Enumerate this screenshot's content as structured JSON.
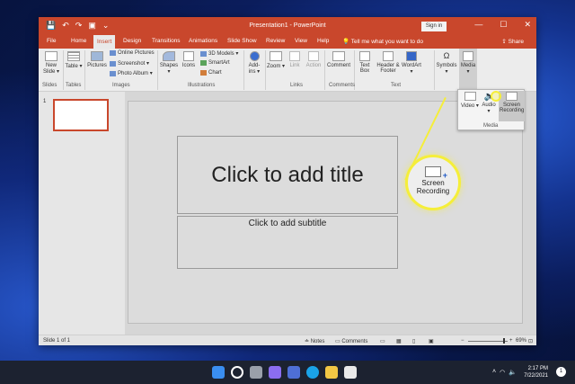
{
  "app": {
    "title": "Presentation1 - PowerPoint",
    "signin": "Sign in",
    "qat": [
      "💾",
      "↶",
      "↷",
      "▣",
      "⌄"
    ],
    "window_controls": [
      "—",
      "☐",
      "✕"
    ]
  },
  "tabs": [
    "File",
    "Home",
    "Insert",
    "Design",
    "Transitions",
    "Animations",
    "Slide Show",
    "Review",
    "View",
    "Help"
  ],
  "active_tab": "Insert",
  "tellme": "Tell me what you want to do",
  "share": "Share",
  "ribbon": {
    "new_slide": "New Slide ▾",
    "table": "Table ▾",
    "pictures": "Pictures",
    "online_pictures": "Online Pictures",
    "screenshot": "Screenshot ▾",
    "photo_album": "Photo Album ▾",
    "shapes": "Shapes ▾",
    "icons": "Icons",
    "models3d": "3D Models ▾",
    "smartart": "SmartArt",
    "chart": "Chart",
    "addins": "Add-ins ▾",
    "zoom": "Zoom ▾",
    "link": "Link",
    "action": "Action",
    "comment": "Comment",
    "textbox": "Text Box",
    "header_footer": "Header & Footer",
    "wordart": "WordArt ▾",
    "symbols": "Symbols ▾",
    "media": "Media ▾",
    "groups": {
      "slides": "Slides",
      "tables": "Tables",
      "images": "Images",
      "illustrations": "Illustrations",
      "links": "Links",
      "comments": "Comments",
      "text": "Text"
    }
  },
  "media_dropdown": {
    "video": "Video ▾",
    "audio": "Audio ▾",
    "screen_recording": "Screen Recording",
    "group": "Media"
  },
  "slide_panel": {
    "slide_number": "1"
  },
  "slide": {
    "title_placeholder": "Click to add title",
    "subtitle_placeholder": "Click to add subtitle"
  },
  "callout": {
    "label": "Screen Recording"
  },
  "statusbar": {
    "slide_info": "Slide 1 of 1",
    "notes": "≐ Notes",
    "comments": "▭ Comments",
    "zoom": "69%"
  },
  "taskbar": {
    "time": "2:17 PM",
    "date": "7/22/2021",
    "notifications": "1",
    "icons_colors": [
      "#3a8ef0",
      "#ffffff",
      "#9aa0aa",
      "#8b6df0",
      "#4e6fd6",
      "#1aa3e8",
      "#f2c744",
      "#e9e9e9"
    ]
  }
}
